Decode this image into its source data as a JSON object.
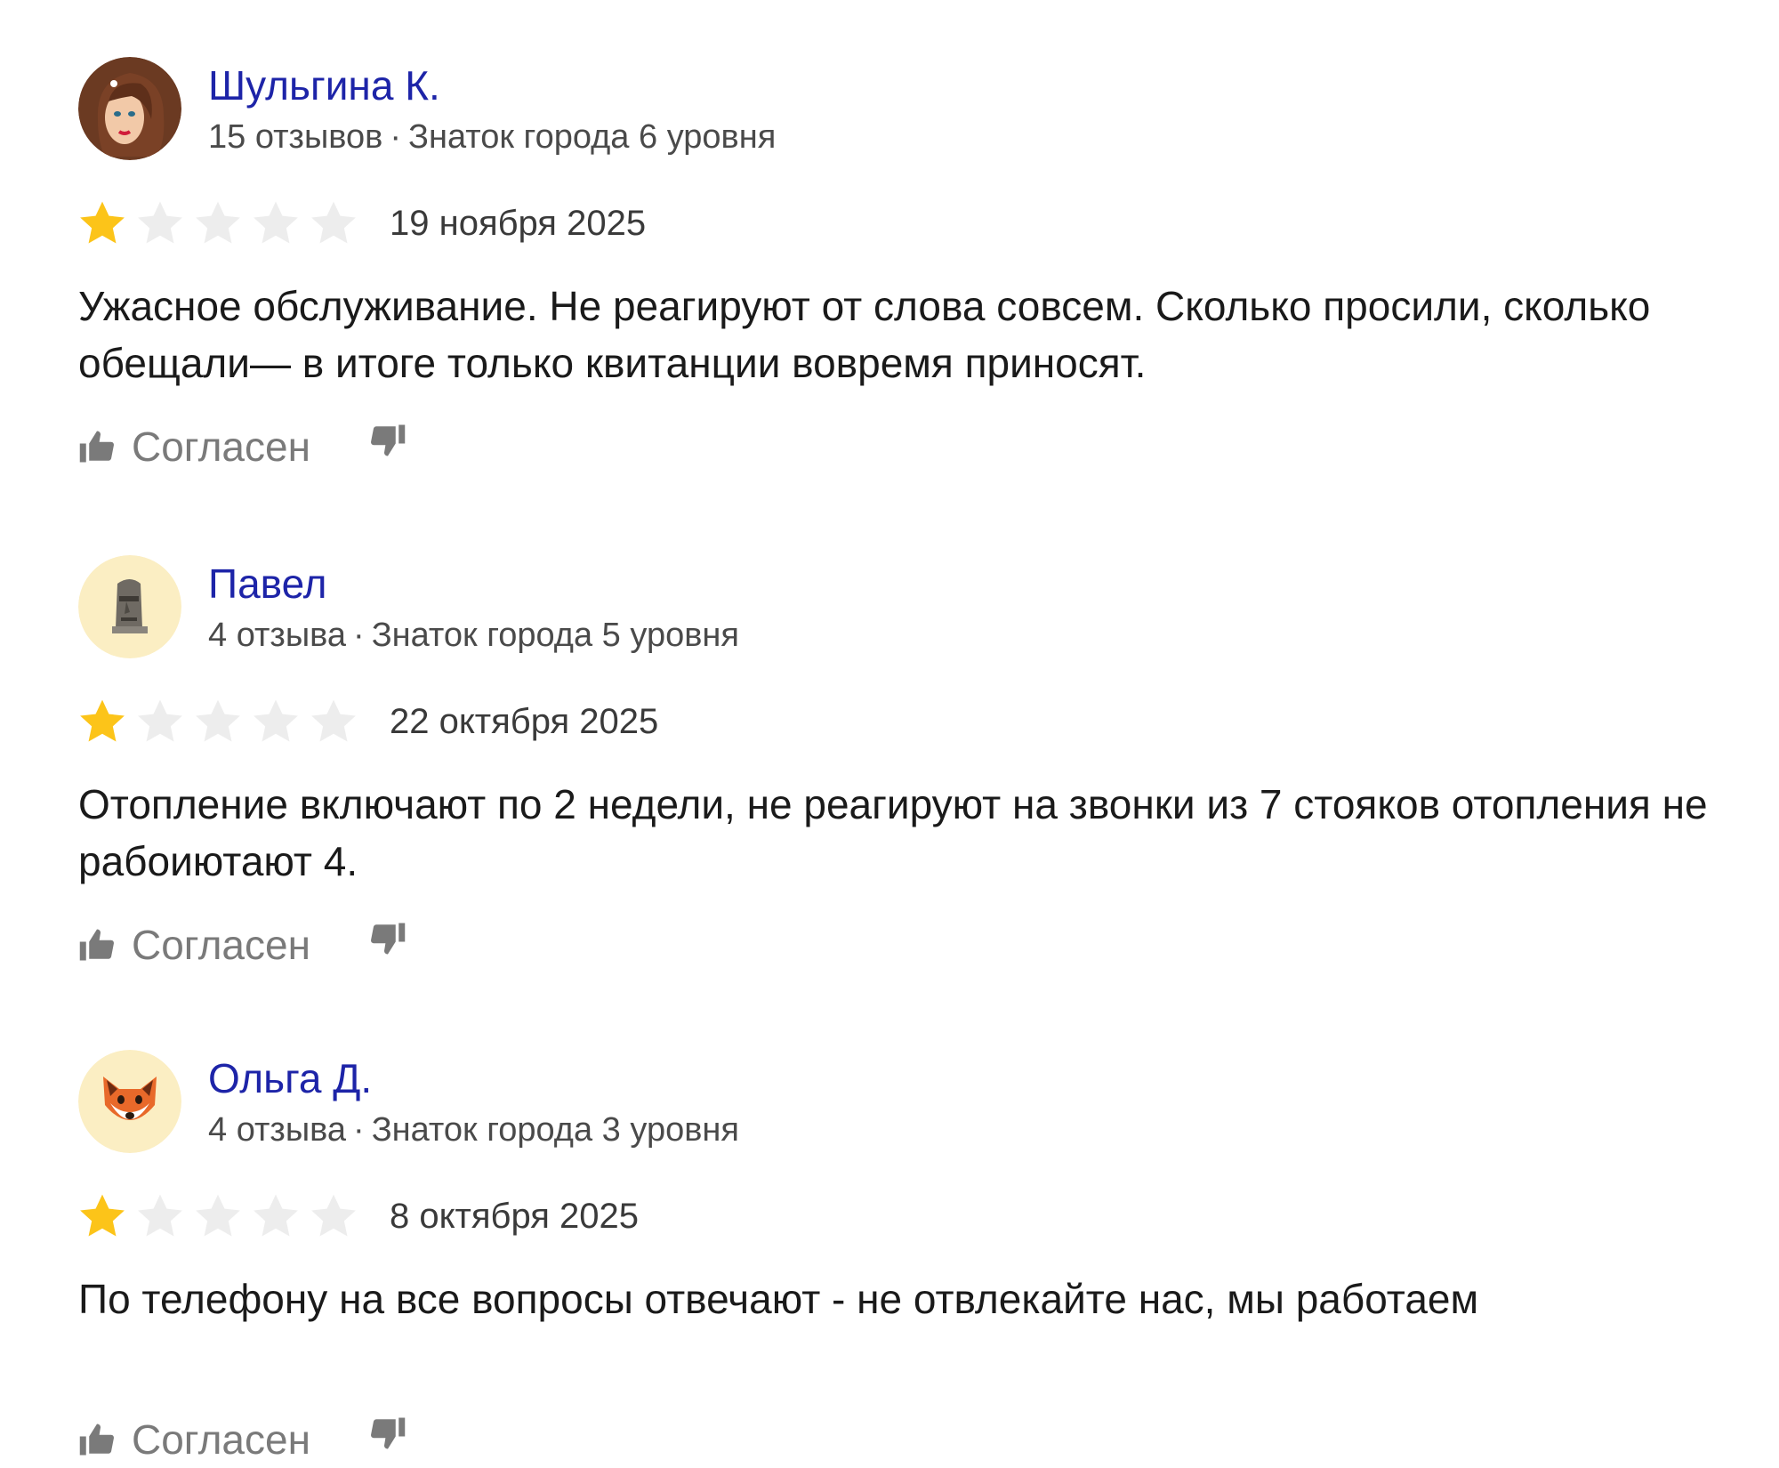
{
  "reviews": [
    {
      "author": "Шульгина К.",
      "reviews_count": "15 отзывов",
      "separator": "·",
      "level": "Знаток города 6 уровня",
      "avatar_icon": "woman-avatar-icon",
      "rating": 1,
      "rating_max": 5,
      "date": "19 ноября 2025",
      "text": "Ужасное обслуживание. Не реагируют от слова совсем. Сколько просили, сколько обещали— в итоге только квитанции вовремя приносят.",
      "agree_label": "Согласен"
    },
    {
      "author": "Павел",
      "reviews_count": "4 отзыва",
      "separator": "·",
      "level": "Знаток города 5 уровня",
      "avatar_icon": "moai-statue-avatar-icon",
      "rating": 1,
      "rating_max": 5,
      "date": "22 октября 2025",
      "text": "Отопление включают по 2 недели, не реагируют на звонки из 7 стояков отопления не рабоиютают 4.",
      "agree_label": "Согласен"
    },
    {
      "author": "Ольга Д.",
      "reviews_count": "4 отзыва",
      "separator": "·",
      "level": "Знаток города 3 уровня",
      "avatar_icon": "fox-avatar-icon",
      "rating": 1,
      "rating_max": 5,
      "date": "8 октября 2025",
      "text": "По телефону на все вопросы отвечают - не отвлекайте нас, мы работаем",
      "agree_label": "Согласен"
    }
  ],
  "colors": {
    "author_link": "#1d24a8",
    "star_filled": "#fcc419",
    "star_empty": "#ededed",
    "meta_text": "#4a4a4a",
    "action_gray": "#7a7a7a"
  }
}
